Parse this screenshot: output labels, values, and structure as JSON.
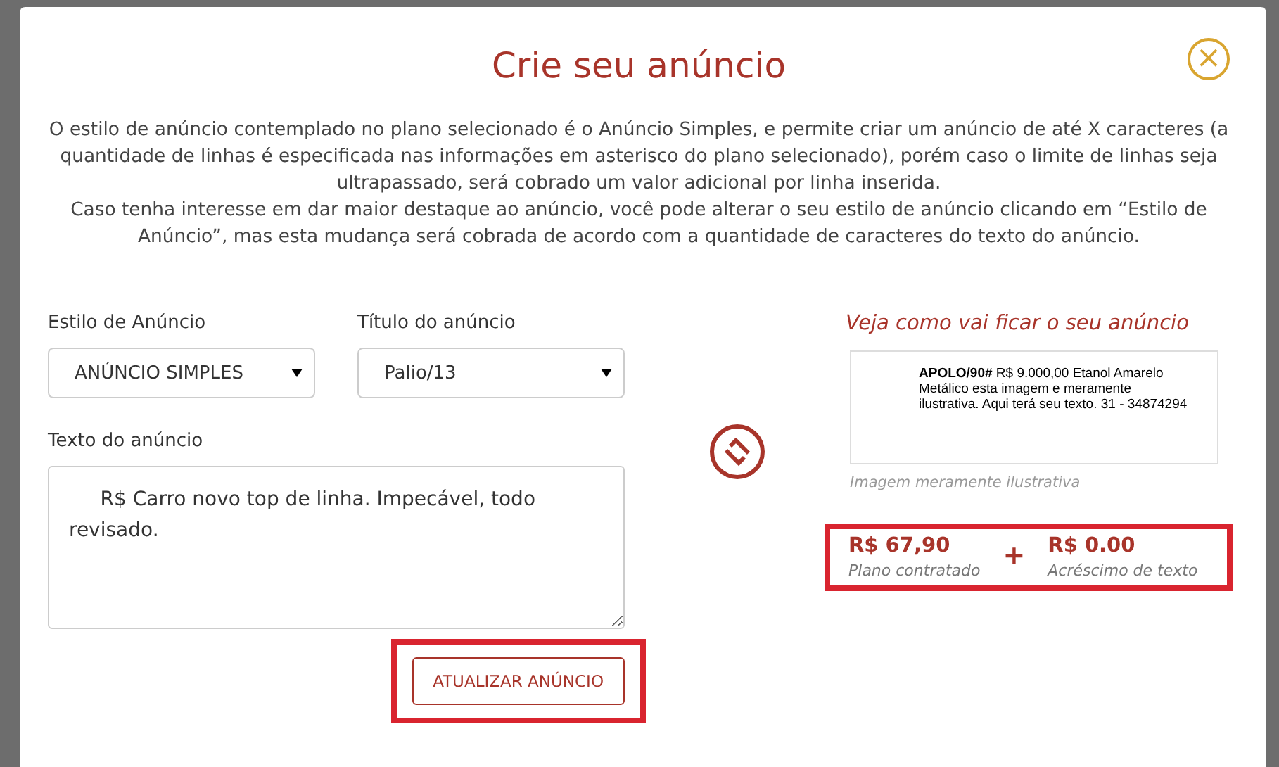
{
  "modal": {
    "title": "Crie seu anúncio",
    "close_icon": "×"
  },
  "description": [
    "O estilo de anúncio contemplado no plano selecionado é o Anúncio Simples, e permite criar um anúncio de até X caracteres (a quantidade de linhas é especificada nas informações em asterisco do plano selecionado), porém caso o limite de linhas seja ultrapassado, será cobrado um valor adicional por linha inserida.",
    "Caso tenha interesse em dar maior destaque ao anúncio, você pode alterar o seu estilo de anúncio clicando em “Estilo de Anúncio”, mas esta mudança será cobrada de acordo com a quantidade de caracteres do texto do anúncio."
  ],
  "form": {
    "selects": [
      {
        "label": "Estilo de Anúncio",
        "value": "ANÚNCIO SIMPLES"
      },
      {
        "label": "Título do anúncio",
        "value": "Palio/13"
      }
    ],
    "text_label": "Texto do anúncio",
    "text_value": "     R$ Carro novo top de linha. Impecável, todo revisado.",
    "button": "ATUALIZAR ANÚNCIO"
  },
  "preview": {
    "heading": "Veja como vai ficar o seu anúncio",
    "ad_text": "**APOLO/90#** R$ 9.000,00 Etanol Amarelo Metálico esta imagem e meramente ilustrativa. Aqui terá seu texto. 31 - 34874294",
    "caption": "Imagem meramente ilustrativa"
  },
  "prices": [
    {
      "amount": "R$ 67,90",
      "label": "Plano contratado"
    },
    {
      "amount": "R$ 0.00",
      "label": "Acréscimo de texto"
    }
  ],
  "price_separator": "+"
}
